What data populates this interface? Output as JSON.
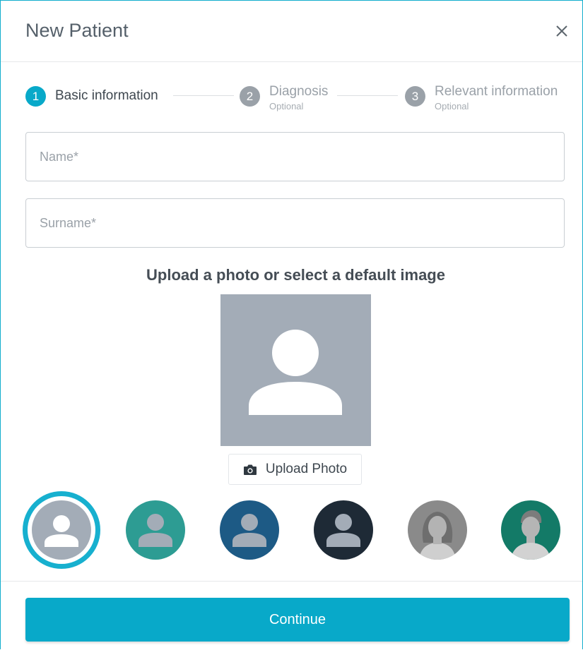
{
  "modal": {
    "title": "New Patient"
  },
  "stepper": {
    "steps": [
      {
        "number": "1",
        "label": "Basic information",
        "sublabel": "",
        "active": true
      },
      {
        "number": "2",
        "label": "Diagnosis",
        "sublabel": "Optional",
        "active": false
      },
      {
        "number": "3",
        "label": "Relevant information",
        "sublabel": "Optional",
        "active": false
      }
    ]
  },
  "form": {
    "name_placeholder": "Name*",
    "name_value": "",
    "surname_placeholder": "Surname*",
    "surname_value": ""
  },
  "photo": {
    "heading": "Upload a photo or select a default image",
    "upload_label": "Upload Photo"
  },
  "default_avatars": [
    {
      "name": "avatar-gray",
      "color": "#a3acb7",
      "selected": true
    },
    {
      "name": "avatar-teal",
      "color": "#2d9c93",
      "selected": false
    },
    {
      "name": "avatar-blue",
      "color": "#1d5a85",
      "selected": false
    },
    {
      "name": "avatar-navy",
      "color": "#1e2a36",
      "selected": false
    },
    {
      "name": "avatar-woman-photo",
      "color": "#8a8a8a",
      "selected": false
    },
    {
      "name": "avatar-man-photo",
      "color": "#137a67",
      "selected": false
    }
  ],
  "footer": {
    "continue_label": "Continue"
  },
  "colors": {
    "accent": "#08a9c9",
    "step_inactive": "#9aa1a8",
    "border": "#12aecd"
  }
}
